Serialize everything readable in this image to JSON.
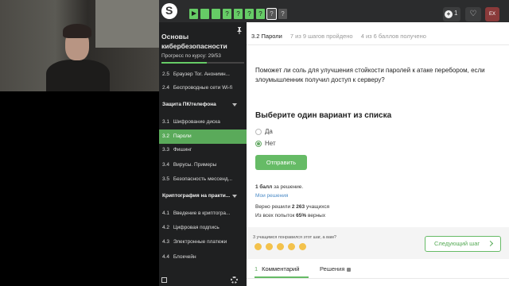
{
  "sidebar": {
    "course_title": "Основы кибербезопасности",
    "progress_label": "Прогресс по курсу:",
    "progress_value": "29/53",
    "progress_fraction": 0.547,
    "items": [
      {
        "num": "2.5",
        "label": "Браузер Tor. Анонимн..."
      },
      {
        "num": "2.4",
        "label": "Беспроводные сети Wi-fi"
      }
    ],
    "section_pc": "Защита ПК/телефона",
    "pc_items": [
      {
        "num": "3.1",
        "label": "Шифрование диска"
      },
      {
        "num": "3.2",
        "label": "Пароли",
        "active": true
      },
      {
        "num": "3.3",
        "label": "Фишинг"
      },
      {
        "num": "3.4",
        "label": "Вирусы. Примеры"
      },
      {
        "num": "3.5",
        "label": "Безопасность мессенд..."
      }
    ],
    "section_crypto": "Криптография на практи...",
    "crypto_items": [
      {
        "num": "4.1",
        "label": "Введение в криптогра..."
      },
      {
        "num": "4.2",
        "label": "Цифровая подпись"
      },
      {
        "num": "4.3",
        "label": "Электронные платежи"
      },
      {
        "num": "4.4",
        "label": "Блокчейн"
      }
    ]
  },
  "topbar": {
    "steps": [
      "play",
      "done",
      "done",
      "?",
      "?",
      "?",
      "?",
      "?",
      "?"
    ],
    "notifications_count": "1",
    "avatar_initials": "EX"
  },
  "main": {
    "step_name": "3.2 Пароли",
    "steps_passed": "7 из 9 шагов пройдено",
    "points_received": "4 из 6 баллов  получено",
    "question": "Поможет ли соль для улучшения стойкости паролей к атаке перебором, если злоумышленник получил доступ к серверу?",
    "task_title": "Выберите один вариант из списка",
    "options": [
      {
        "label": "Да",
        "checked": false
      },
      {
        "label": "Нет",
        "checked": true
      }
    ],
    "submit_label": "Отправить",
    "score_bold": "1 балл",
    "score_rest": " за решение.",
    "my_solutions": "Мои решения",
    "solved_prefix": "Верно решили ",
    "solved_count": "2 263",
    "solved_suffix": " учащихся",
    "attempts_prefix": "Из всех попыток ",
    "attempts_pct": "65%",
    "attempts_suffix": " верных",
    "feedback_question": "3 учащимся понравился этот шаг, а вам?",
    "next_step_label": "Следующий шаг",
    "tab_comments_num": "1",
    "tab_comments_label": "Комментарий",
    "tab_solutions_label": "Решения"
  },
  "colors": {
    "accent": "#66bb66",
    "sidebar_bg": "#1f2021",
    "topbar_bg": "#2b2c2d",
    "link": "#4a8ac6"
  }
}
